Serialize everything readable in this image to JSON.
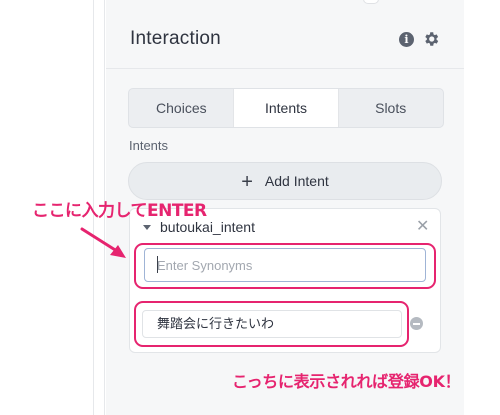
{
  "panel": {
    "title": "Interaction",
    "info_glyph": "i",
    "icons": [
      "info-icon",
      "gear-icon"
    ]
  },
  "tabs": [
    {
      "label": "Choices",
      "active": false
    },
    {
      "label": "Intents",
      "active": true
    },
    {
      "label": "Slots",
      "active": false
    }
  ],
  "intents": {
    "section_label": "Intents",
    "add_button_label": "Add Intent",
    "add_icon": "+",
    "current_intent": "butoukai_intent",
    "close_glyph": "✕",
    "synonym_input": {
      "value": "",
      "placeholder": "Enter Synonyms"
    },
    "synonyms": [
      "舞踏会に行きたいわ"
    ]
  },
  "annotations": {
    "input_hint": "ここに入力してENTER",
    "result_hint": "こっちに表示されれば登録OK！",
    "accent_color": "#e6246f"
  }
}
